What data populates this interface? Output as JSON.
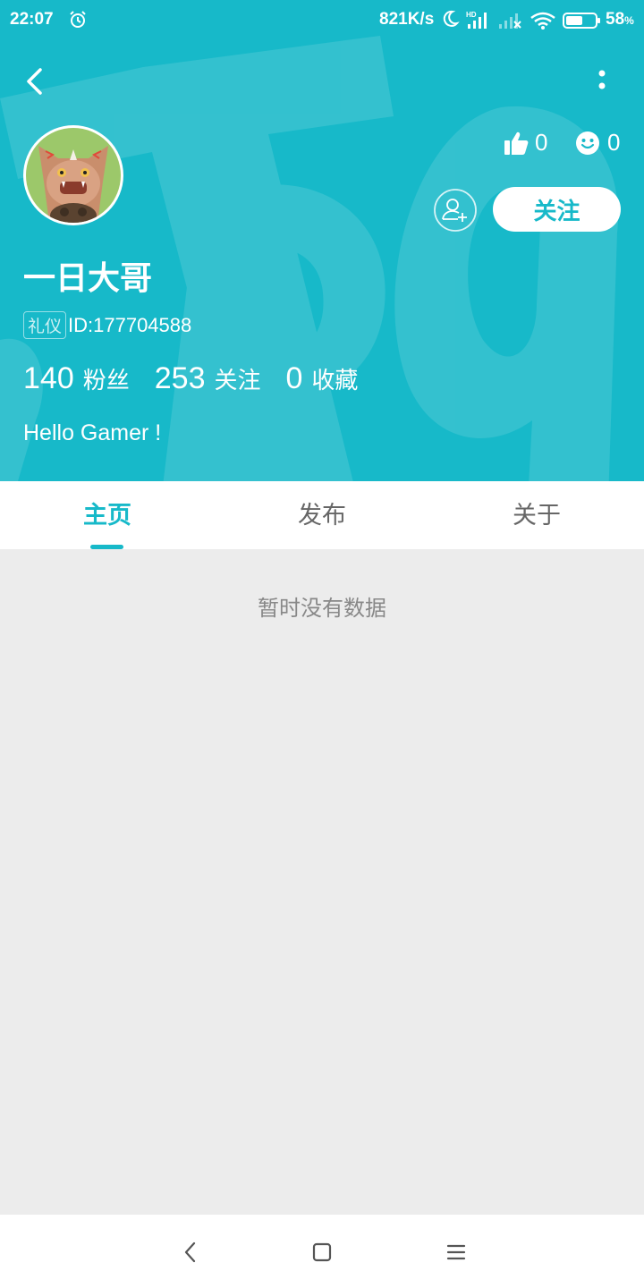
{
  "status_bar": {
    "time": "22:07",
    "network_speed": "821K/s",
    "battery_percent": "58",
    "battery_unit": "%",
    "battery_level": 0.58
  },
  "header": {
    "accent_color": "#17b9c9",
    "watermark_icon": "taptap-logo-watermark"
  },
  "profile": {
    "username": "一日大哥",
    "badge": "礼仪",
    "id_text": "ID:177704588",
    "likes": "0",
    "smiles": "0",
    "follow_label": "关注",
    "bio": "Hello Gamer !",
    "stats": [
      {
        "value": "140",
        "label": "粉丝"
      },
      {
        "value": "253",
        "label": "关注"
      },
      {
        "value": "0",
        "label": "收藏"
      }
    ]
  },
  "tabs": [
    {
      "label": "主页",
      "active": true
    },
    {
      "label": "发布",
      "active": false
    },
    {
      "label": "关于",
      "active": false
    }
  ],
  "empty_message": "暂时没有数据"
}
